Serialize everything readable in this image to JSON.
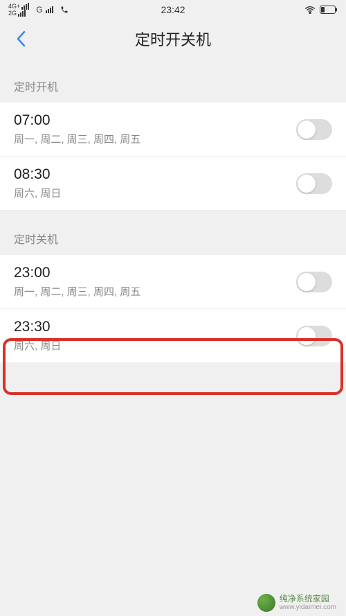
{
  "status_bar": {
    "net1_label": "4G+",
    "net2_label": "2G",
    "net3_label": "G",
    "time": "23:42"
  },
  "nav": {
    "title": "定时开关机"
  },
  "sections": {
    "power_on": {
      "header": "定时开机",
      "items": [
        {
          "time": "07:00",
          "days": "周一, 周二, 周三, 周四, 周五"
        },
        {
          "time": "08:30",
          "days": "周六, 周日"
        }
      ]
    },
    "power_off": {
      "header": "定时关机",
      "items": [
        {
          "time": "23:00",
          "days": "周一, 周二, 周三, 周四, 周五"
        },
        {
          "time": "23:30",
          "days": "周六, 周日"
        }
      ]
    }
  },
  "watermark": {
    "line1": "纯净系统家园",
    "line2": "www.yidaimei.com"
  }
}
